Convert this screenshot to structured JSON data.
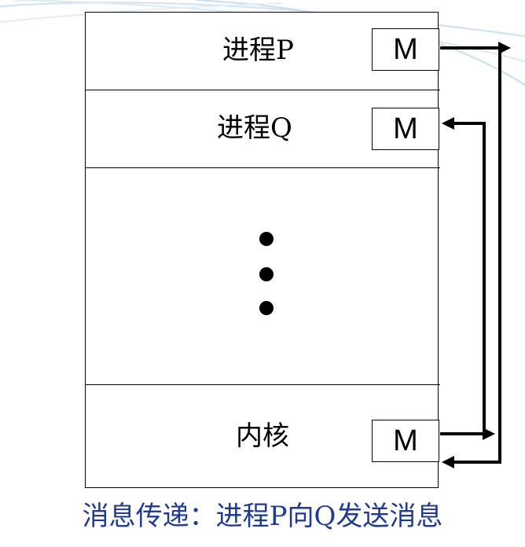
{
  "diagram": {
    "sections": [
      {
        "label": "进程P",
        "m_label": "M"
      },
      {
        "label": "进程Q",
        "m_label": "M"
      },
      {
        "label": "",
        "ellipsis": "•••"
      },
      {
        "label": "内核",
        "m_label": "M"
      }
    ],
    "caption": "消息传递：进程P向Q发送消息"
  }
}
